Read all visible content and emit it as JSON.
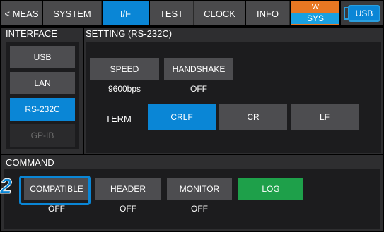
{
  "tabs": {
    "meas": "< MEAS",
    "system": "SYSTEM",
    "if": "I/F",
    "test": "TEST",
    "clock": "CLOCK",
    "info": "INFO",
    "sys_top": "W",
    "sys_bottom": "SYS",
    "usb": "USB"
  },
  "interface": {
    "title": "INTERFACE",
    "items": [
      "USB",
      "LAN",
      "RS-232C",
      "GP-IB"
    ],
    "selected": "RS-232C"
  },
  "setting": {
    "title": "SETTING (RS-232C)",
    "speed_label": "SPEED",
    "speed_value": "9600bps",
    "handshake_label": "HANDSHAKE",
    "handshake_value": "OFF",
    "term_label": "TERM",
    "term_options": [
      "CRLF",
      "CR",
      "LF"
    ],
    "term_selected": "CRLF"
  },
  "command": {
    "title": "COMMAND",
    "compatible_label": "COMPATIBLE",
    "compatible_value": "OFF",
    "header_label": "HEADER",
    "header_value": "OFF",
    "monitor_label": "MONITOR",
    "monitor_value": "OFF",
    "log_label": "LOG"
  },
  "callout": "2",
  "colors": {
    "accent": "#0a86d6",
    "active_green": "#1ea04a",
    "sys_orange": "#e87722"
  }
}
